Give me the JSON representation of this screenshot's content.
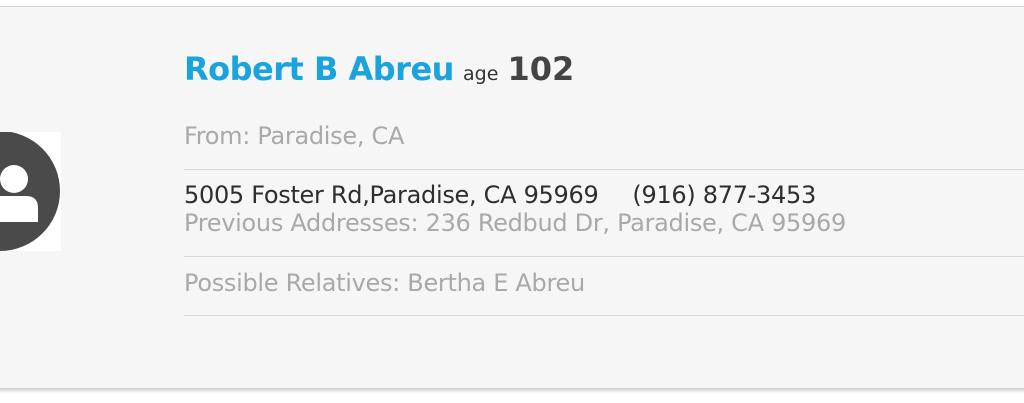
{
  "person": {
    "name": "Robert B Abreu",
    "age_label": "age",
    "age": "102",
    "from": "From: Paradise, CA",
    "address": "5005 Foster Rd,Paradise, CA 95969",
    "phone": "(916) 877-3453",
    "previous_addresses": "Previous Addresses: 236 Redbud Dr, Paradise, CA 95969",
    "relatives": "Possible Relatives: Bertha E Abreu"
  },
  "icons": {
    "avatar": "user-avatar-icon"
  },
  "colors": {
    "name_accent": "#1ba3de",
    "muted_text": "#a9a9a9",
    "dark_text": "#2e2e2e",
    "card_background": "#f6f6f6",
    "avatar_fill": "#4a4a4a"
  }
}
